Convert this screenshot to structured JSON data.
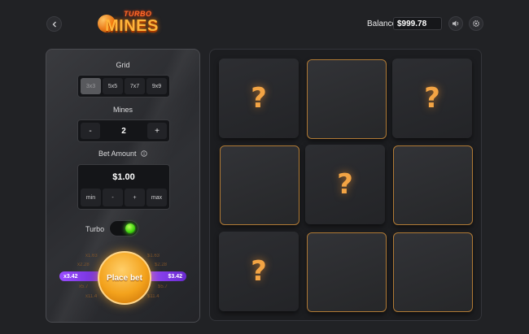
{
  "header": {
    "logo_turbo": "TURBO",
    "logo_mines": "MINES",
    "balance_label": "Balance:",
    "balance_value": "$999.78"
  },
  "panel": {
    "grid_label": "Grid",
    "grid_options": [
      "3x3",
      "5x5",
      "7x7",
      "9x9"
    ],
    "grid_selected": "3x3",
    "mines_label": "Mines",
    "mines_value": "2",
    "mines_minus": "-",
    "mines_plus": "+",
    "bet_label": "Bet Amount",
    "bet_value": "$1.00",
    "bet_buttons": [
      "min",
      "-",
      "+",
      "max"
    ],
    "turbo_label": "Turbo",
    "turbo_on": true,
    "place_bet_label": "Place bet",
    "multipliers": {
      "left_top": "x1.63",
      "left_2": "x2.28",
      "active_left": "x3.42",
      "left_4": "x5.7",
      "left_5": "x11.4",
      "right_top": "$1.63",
      "right_2": "$2.28",
      "active_right": "$3.42",
      "right_4": "$5.7",
      "right_5": "$11.4"
    }
  },
  "board": {
    "tiles": [
      {
        "state": "revealed",
        "symbol": "?"
      },
      {
        "state": "hidden",
        "symbol": ""
      },
      {
        "state": "revealed",
        "symbol": "?"
      },
      {
        "state": "hidden",
        "symbol": ""
      },
      {
        "state": "revealed",
        "symbol": "?"
      },
      {
        "state": "hidden",
        "symbol": ""
      },
      {
        "state": "revealed",
        "symbol": "?"
      },
      {
        "state": "hidden",
        "symbol": ""
      },
      {
        "state": "hidden",
        "symbol": ""
      }
    ]
  },
  "colors": {
    "accent_orange": "#f3a444",
    "toggle_green": "#3fd40e",
    "multiplier_purple": "#9a4cff"
  }
}
